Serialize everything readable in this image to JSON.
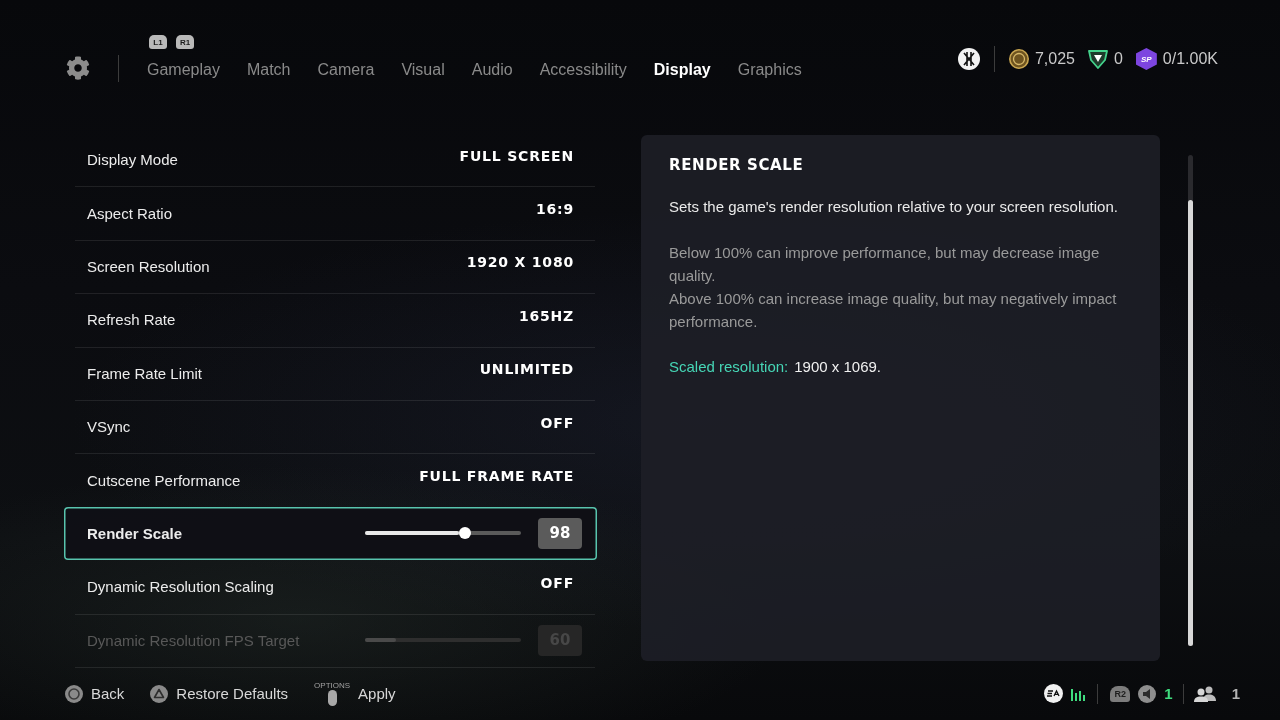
{
  "header": {
    "bumpers": [
      "L1",
      "R1"
    ],
    "tabs": [
      {
        "label": "Gameplay",
        "selected": false
      },
      {
        "label": "Match",
        "selected": false
      },
      {
        "label": "Camera",
        "selected": false
      },
      {
        "label": "Visual",
        "selected": false
      },
      {
        "label": "Audio",
        "selected": false
      },
      {
        "label": "Accessibility",
        "selected": false
      },
      {
        "label": "Display",
        "selected": true
      },
      {
        "label": "Graphics",
        "selected": false
      }
    ],
    "currencies": [
      {
        "kind": "coins",
        "amount": "7,025"
      },
      {
        "kind": "points",
        "amount": "0"
      },
      {
        "kind": "season",
        "badge": "SP",
        "amount": "0/1.00K"
      }
    ]
  },
  "settings": [
    {
      "kind": "option",
      "label": "Display Mode",
      "value": "FULL SCREEN",
      "selected": false,
      "disabled": false
    },
    {
      "kind": "option",
      "label": "Aspect Ratio",
      "value": "16:9",
      "selected": false,
      "disabled": false
    },
    {
      "kind": "option",
      "label": "Screen Resolution",
      "value": "1920 X 1080",
      "selected": false,
      "disabled": false
    },
    {
      "kind": "option",
      "label": "Refresh Rate",
      "value": "165HZ",
      "selected": false,
      "disabled": false
    },
    {
      "kind": "option",
      "label": "Frame Rate Limit",
      "value": "UNLIMITED",
      "selected": false,
      "disabled": false
    },
    {
      "kind": "option",
      "label": "VSync",
      "value": "OFF",
      "selected": false,
      "disabled": false
    },
    {
      "kind": "option",
      "label": "Cutscene Performance",
      "value": "FULL FRAME RATE",
      "selected": false,
      "disabled": false
    },
    {
      "kind": "slider",
      "label": "Render Scale",
      "level": 0.64,
      "value": "98",
      "selected": true,
      "disabled": false
    },
    {
      "kind": "option",
      "label": "Dynamic Resolution Scaling",
      "value": "OFF",
      "selected": false,
      "disabled": false
    },
    {
      "kind": "slider",
      "label": "Dynamic Resolution FPS Target",
      "level": 0.2,
      "value": "60",
      "selected": false,
      "disabled": true
    }
  ],
  "description": {
    "title": "RENDER SCALE",
    "paragraphs": [
      {
        "kind": "primary",
        "text": "Sets the game's render resolution relative to your screen resolution."
      },
      {
        "kind": "secondary",
        "text": "Below 100% can improve performance, but may decrease image quality."
      },
      {
        "kind": "secondary",
        "text": "Above 100% can increase image quality, but may negatively impact performance."
      }
    ],
    "scaled": {
      "label": "Scaled resolution:",
      "value": "1900 x 1069."
    }
  },
  "footer": {
    "hints": [
      {
        "kind": "circle",
        "label": "Back"
      },
      {
        "kind": "triangle",
        "label": "Restore Defaults"
      },
      {
        "kind": "options",
        "caption": "OPTIONS",
        "label": "Apply"
      }
    ],
    "status": {
      "trigger_badge": "R2",
      "voice_count": "1",
      "party_count": "1"
    }
  }
}
